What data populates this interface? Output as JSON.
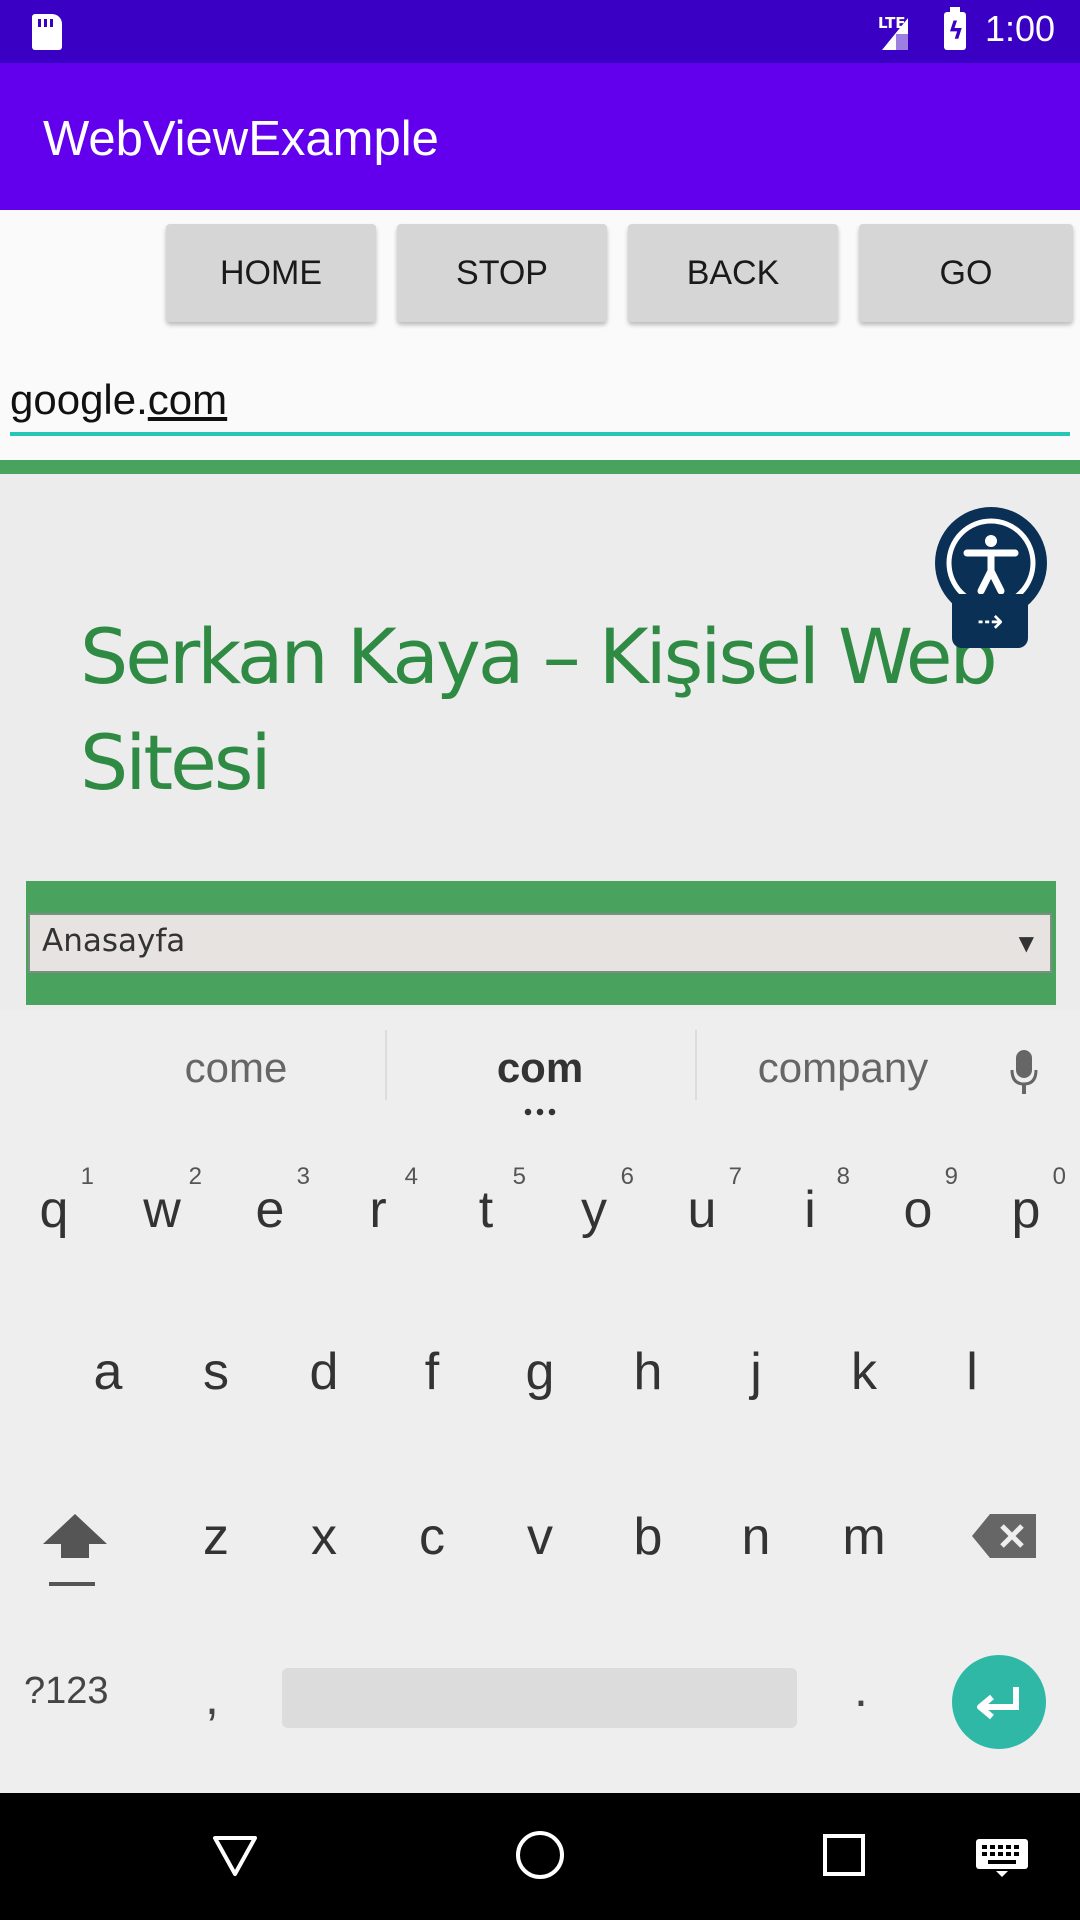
{
  "status_bar": {
    "time": "1:00",
    "network_label": "LTE",
    "icons": [
      "sd-card-icon",
      "signal-icon",
      "battery-charging-icon"
    ]
  },
  "app_bar": {
    "title": "WebViewExample"
  },
  "toolbar": {
    "home_label": "HOME",
    "stop_label": "STOP",
    "back_label": "BACK",
    "go_label": "GO"
  },
  "url_field": {
    "prefix": "google.",
    "suffix": "com"
  },
  "web_page": {
    "site_title": "Serkan Kaya – Kişisel Web Sitesi",
    "menu_selected": "Anasayfa",
    "accent_color": "#4aa25f",
    "title_color": "#2f8a43",
    "accessibility_widget_color": "#0b3056"
  },
  "keyboard": {
    "suggestions": [
      "come",
      "com",
      "company"
    ],
    "row1": [
      {
        "key": "q",
        "hint": "1"
      },
      {
        "key": "w",
        "hint": "2"
      },
      {
        "key": "e",
        "hint": "3"
      },
      {
        "key": "r",
        "hint": "4"
      },
      {
        "key": "t",
        "hint": "5"
      },
      {
        "key": "y",
        "hint": "6"
      },
      {
        "key": "u",
        "hint": "7"
      },
      {
        "key": "i",
        "hint": "8"
      },
      {
        "key": "o",
        "hint": "9"
      },
      {
        "key": "p",
        "hint": "0"
      }
    ],
    "row2": [
      "a",
      "s",
      "d",
      "f",
      "g",
      "h",
      "j",
      "k",
      "l"
    ],
    "row3": [
      "z",
      "x",
      "c",
      "v",
      "b",
      "n",
      "m"
    ],
    "symbols_label": "?123",
    "comma_label": ",",
    "period_label": ".",
    "enter_color": "#2fb8a6"
  },
  "nav_bar": {
    "icons": [
      "back-icon",
      "home-icon",
      "recents-icon",
      "keyboard-switch-icon"
    ]
  }
}
